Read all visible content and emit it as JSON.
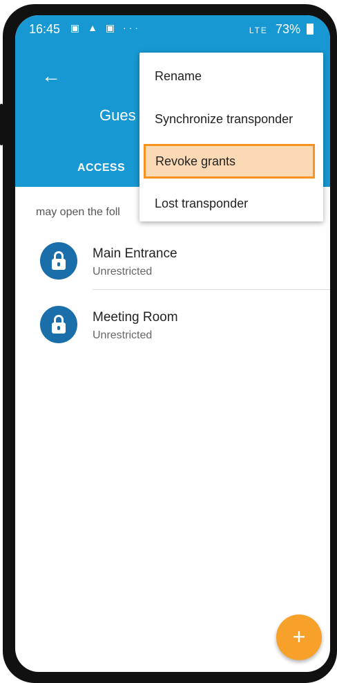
{
  "status_bar": {
    "time": "16:45",
    "left_icons": "▣ ▲ ▣ ···",
    "network": "LTE",
    "battery": "73%"
  },
  "app_bar": {
    "title": "Gues",
    "tab_access": "ACCESS"
  },
  "content": {
    "subheader": "may open the foll",
    "items": [
      {
        "title": "Main Entrance",
        "subtitle": "Unrestricted",
        "icon": "lock-icon"
      },
      {
        "title": "Meeting Room",
        "subtitle": "Unrestricted",
        "icon": "lock-icon"
      }
    ]
  },
  "menu": {
    "items": [
      {
        "label": "Rename"
      },
      {
        "label": "Synchronize transponder"
      },
      {
        "label": "Revoke grants",
        "highlighted": true
      },
      {
        "label": "Lost transponder"
      }
    ]
  },
  "fab": {
    "label": "+"
  },
  "colors": {
    "primary": "#1798d2",
    "lock": "#1a6faa",
    "accent": "#f7a12b",
    "highlight_fill": "#fcd9b5",
    "highlight_border": "#f7931e"
  }
}
